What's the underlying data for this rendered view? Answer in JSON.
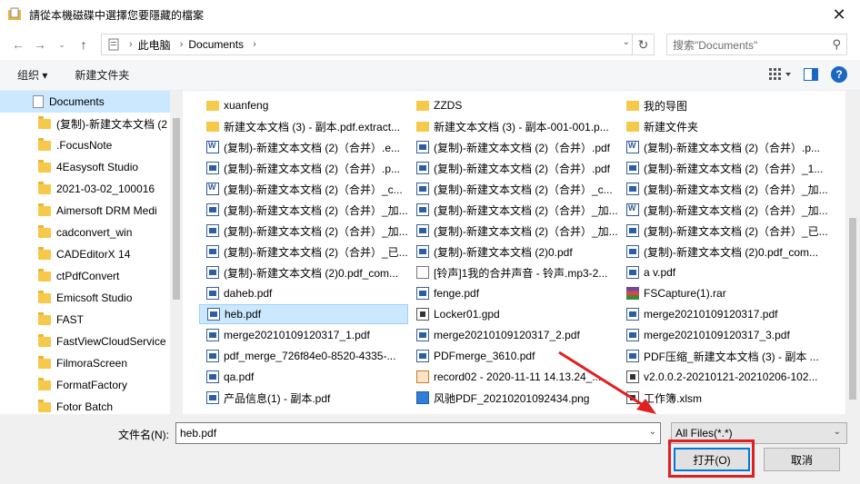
{
  "window": {
    "title": "請從本機磁碟中選擇您要隱藏的檔案",
    "close_glyph": "✕"
  },
  "address": {
    "path": [
      "此电脑",
      "Documents"
    ],
    "search_placeholder": "搜索\"Documents\""
  },
  "toolbar": {
    "organize": "组织 ▾",
    "new_folder": "新建文件夹"
  },
  "sidebar": {
    "items": [
      {
        "label": "Documents",
        "type": "doc",
        "selected": true
      },
      {
        "label": "(复制)-新建文本文档 (2",
        "type": "folder"
      },
      {
        "label": ".FocusNote",
        "type": "folder"
      },
      {
        "label": "4Easysoft Studio",
        "type": "folder"
      },
      {
        "label": "2021-03-02_100016",
        "type": "folder"
      },
      {
        "label": "Aimersoft DRM Medi",
        "type": "folder"
      },
      {
        "label": "cadconvert_win",
        "type": "folder"
      },
      {
        "label": "CADEditorX 14",
        "type": "folder"
      },
      {
        "label": "ctPdfConvert",
        "type": "folder"
      },
      {
        "label": "Emicsoft Studio",
        "type": "folder"
      },
      {
        "label": "FAST",
        "type": "folder"
      },
      {
        "label": "FastViewCloudService",
        "type": "folder"
      },
      {
        "label": "FilmoraScreen",
        "type": "folder"
      },
      {
        "label": "FormatFactory",
        "type": "folder"
      },
      {
        "label": "Fotor Batch",
        "type": "folder"
      }
    ]
  },
  "files": {
    "col1": [
      {
        "name": "xuanfeng",
        "icon": "folder"
      },
      {
        "name": "新建文本文档 (3) - 副本.pdf.extract...",
        "icon": "folder"
      },
      {
        "name": "(复制)-新建文本文档 (2)（合并）.e...",
        "icon": "word"
      },
      {
        "name": "(复制)-新建文本文档 (2)（合并）.p...",
        "icon": "pdf"
      },
      {
        "name": "(复制)-新建文本文档 (2)（合并）_c...",
        "icon": "word"
      },
      {
        "name": "(复制)-新建文本文档 (2)（合并）_加...",
        "icon": "pdf"
      },
      {
        "name": "(复制)-新建文本文档 (2)（合并）_加...",
        "icon": "pdf"
      },
      {
        "name": "(复制)-新建文本文档 (2)（合并）_已...",
        "icon": "pdf"
      },
      {
        "name": "(复制)-新建文本文档 (2)0.pdf_com...",
        "icon": "pdf"
      },
      {
        "name": "daheb.pdf",
        "icon": "pdf"
      },
      {
        "name": "heb.pdf",
        "icon": "pdf",
        "selected": true
      },
      {
        "name": "merge20210109120317_1.pdf",
        "icon": "pdf"
      },
      {
        "name": "pdf_merge_726f84e0-8520-4335-...",
        "icon": "pdf"
      },
      {
        "name": "qa.pdf",
        "icon": "pdf"
      },
      {
        "name": "产品信息(1) - 副本.pdf",
        "icon": "pdf"
      }
    ],
    "col2": [
      {
        "name": "ZZDS",
        "icon": "folder"
      },
      {
        "name": "新建文本文档 (3) - 副本-001-001.p...",
        "icon": "folder"
      },
      {
        "name": "(复制)-新建文本文档 (2)（合并）.pdf",
        "icon": "pdf"
      },
      {
        "name": "(复制)-新建文本文档 (2)（合并）.pdf",
        "icon": "pdf"
      },
      {
        "name": "(复制)-新建文本文档 (2)（合并）_c...",
        "icon": "pdf"
      },
      {
        "name": "(复制)-新建文本文档 (2)（合并）_加...",
        "icon": "pdf"
      },
      {
        "name": "(复制)-新建文本文档 (2)（合并）_加...",
        "icon": "pdf"
      },
      {
        "name": "(复制)-新建文本文档 (2)0.pdf",
        "icon": "pdf"
      },
      {
        "name": "[铃声]1我的合并声音 - 铃声.mp3-2...",
        "icon": "gen"
      },
      {
        "name": "fenge.pdf",
        "icon": "pdf"
      },
      {
        "name": "Locker01.gpd",
        "icon": "xls"
      },
      {
        "name": "merge20210109120317_2.pdf",
        "icon": "pdf"
      },
      {
        "name": "PDFmerge_3610.pdf",
        "icon": "pdf"
      },
      {
        "name": "record02 - 2020-11-11 14.13.24_...",
        "icon": "mp3"
      },
      {
        "name": "风驰PDF_20210201092434.png",
        "icon": "img"
      }
    ],
    "col3": [
      {
        "name": "我的导图",
        "icon": "folder"
      },
      {
        "name": "新建文件夹",
        "icon": "folder"
      },
      {
        "name": "(复制)-新建文本文档 (2)（合并）.p...",
        "icon": "word"
      },
      {
        "name": "(复制)-新建文本文档 (2)（合并）_1...",
        "icon": "pdf"
      },
      {
        "name": "(复制)-新建文本文档 (2)（合并）_加...",
        "icon": "pdf"
      },
      {
        "name": "(复制)-新建文本文档 (2)（合并）_加...",
        "icon": "word"
      },
      {
        "name": "(复制)-新建文本文档 (2)（合并）_已...",
        "icon": "pdf"
      },
      {
        "name": "(复制)-新建文本文档 (2)0.pdf_com...",
        "icon": "pdf"
      },
      {
        "name": "a v.pdf",
        "icon": "pdf"
      },
      {
        "name": "FSCapture(1).rar",
        "icon": "rar"
      },
      {
        "name": "merge20210109120317.pdf",
        "icon": "pdf"
      },
      {
        "name": "merge20210109120317_3.pdf",
        "icon": "pdf"
      },
      {
        "name": "PDF压缩_新建文本文档 (3) - 副本 ...",
        "icon": "pdf"
      },
      {
        "name": "v2.0.0.2-20210121-20210206-102...",
        "icon": "xls"
      },
      {
        "name": "工作簿.xlsm",
        "icon": "xls"
      }
    ]
  },
  "bottom": {
    "filename_label": "文件名(N):",
    "filename_value": "heb.pdf",
    "filter_value": "All Files(*.*)",
    "open_label": "打开(O)",
    "cancel_label": "取消"
  },
  "colors": {
    "accent": "#0078d7",
    "highlight": "#e02020",
    "selection": "#cce8ff"
  }
}
